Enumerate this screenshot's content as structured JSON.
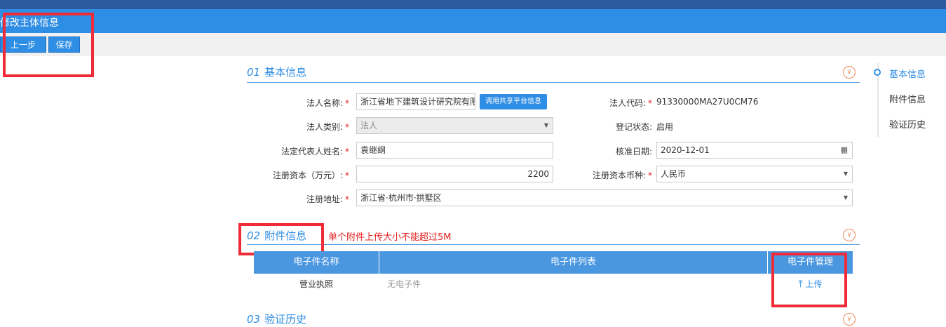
{
  "header": {
    "title": "修改主体信息"
  },
  "toolbar": {
    "prev_label": "上一步",
    "save_label": "保存"
  },
  "sections": {
    "basic": {
      "num": "01",
      "title": "基本信息"
    },
    "attach": {
      "num": "02",
      "title": "附件信息",
      "warning": "单个附件上传大小不能超过5M"
    },
    "history": {
      "num": "03",
      "title": "验证历史"
    }
  },
  "form": {
    "legal_name": {
      "label": "法人名称:",
      "value": "浙江省地下建筑设计研究院有限"
    },
    "share_button": "调用共享平台信息",
    "legal_code": {
      "label": "法人代码:",
      "value": "91330000MA27U0CM76"
    },
    "legal_type": {
      "label": "法人类别:",
      "value": "法人"
    },
    "reg_status": {
      "label": "登记状态:",
      "value": "启用"
    },
    "rep_name": {
      "label": "法定代表人姓名:",
      "value": "袁继纲"
    },
    "approve_date": {
      "label": "核准日期:",
      "value": "2020-12-01"
    },
    "capital": {
      "label": "注册资本（万元）:",
      "value": "2200"
    },
    "currency": {
      "label": "注册资本币种:",
      "value": "人民币"
    },
    "address": {
      "label": "注册地址:",
      "value": "浙江省·杭州市·拱墅区"
    }
  },
  "attachments": {
    "headers": [
      "电子件名称",
      "电子件列表",
      "电子件管理"
    ],
    "rows": [
      {
        "name": "营业执照",
        "list": "无电子件",
        "action": "上传"
      }
    ]
  },
  "right_nav": {
    "items": [
      "基本信息",
      "附件信息",
      "验证历史"
    ]
  },
  "colors": {
    "accent": "#2e8de4",
    "highlight": "#ee2b37",
    "required": "#e42222"
  }
}
